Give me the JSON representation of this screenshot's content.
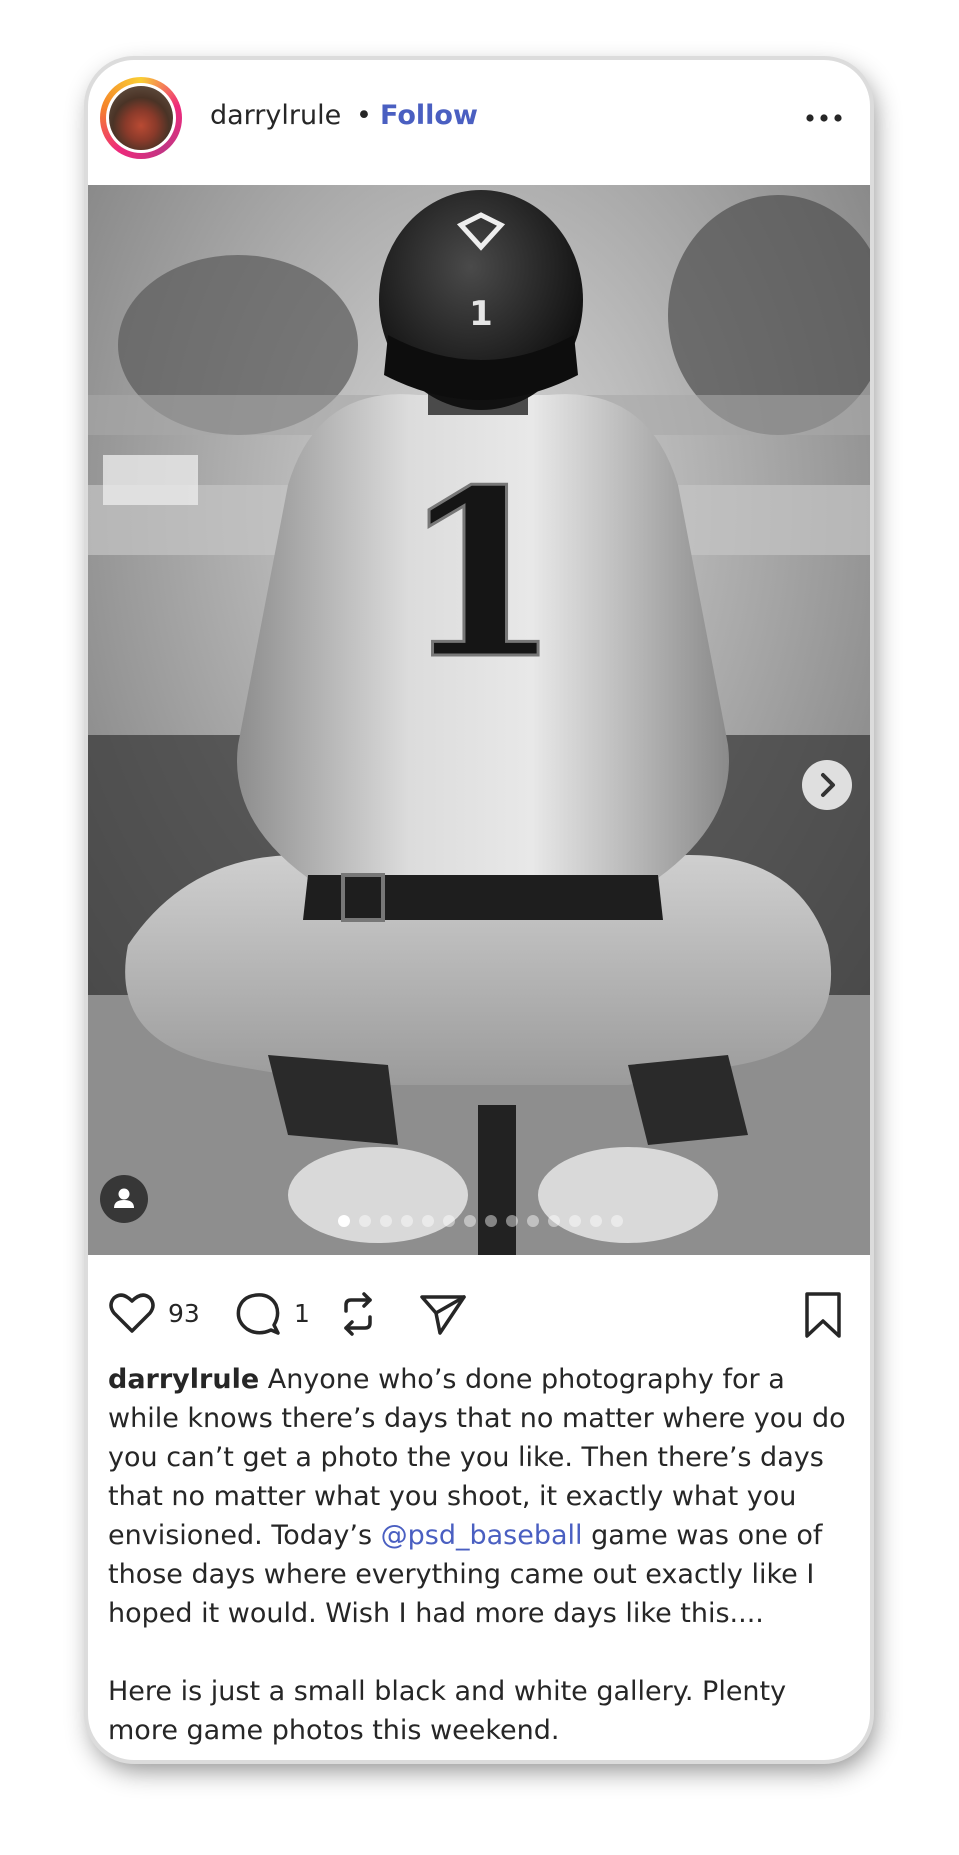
{
  "post": {
    "username": "darrylrule",
    "separator": "•",
    "follow_label": "Follow",
    "likes": "93",
    "comments": "1",
    "caption_username": "darrylrule",
    "caption_part1": " Anyone who’s done photography for a while knows there’s days that no matter where you do you can’t get a photo the you like. Then there’s days that no matter what you shoot, it exactly what you envisioned. Today’s ",
    "caption_mention": "@psd_baseball",
    "caption_part2": " game was one of those days where everything came out exactly like I hoped it would. Wish I had more days like this....",
    "caption_paragraph2": "Here is just a small black and white gallery. Plenty more game photos this weekend.",
    "jersey_number": "1",
    "carousel_total": 14,
    "carousel_active": 1
  },
  "icons": {
    "more": "more-dots-icon",
    "like": "heart-icon",
    "comment": "comment-icon",
    "repost": "repost-icon",
    "share": "send-icon",
    "save": "bookmark-icon",
    "next": "chevron-right-icon",
    "tagged": "user-tag-icon"
  },
  "colors": {
    "link": "#4a5fc1",
    "text": "#262626"
  }
}
